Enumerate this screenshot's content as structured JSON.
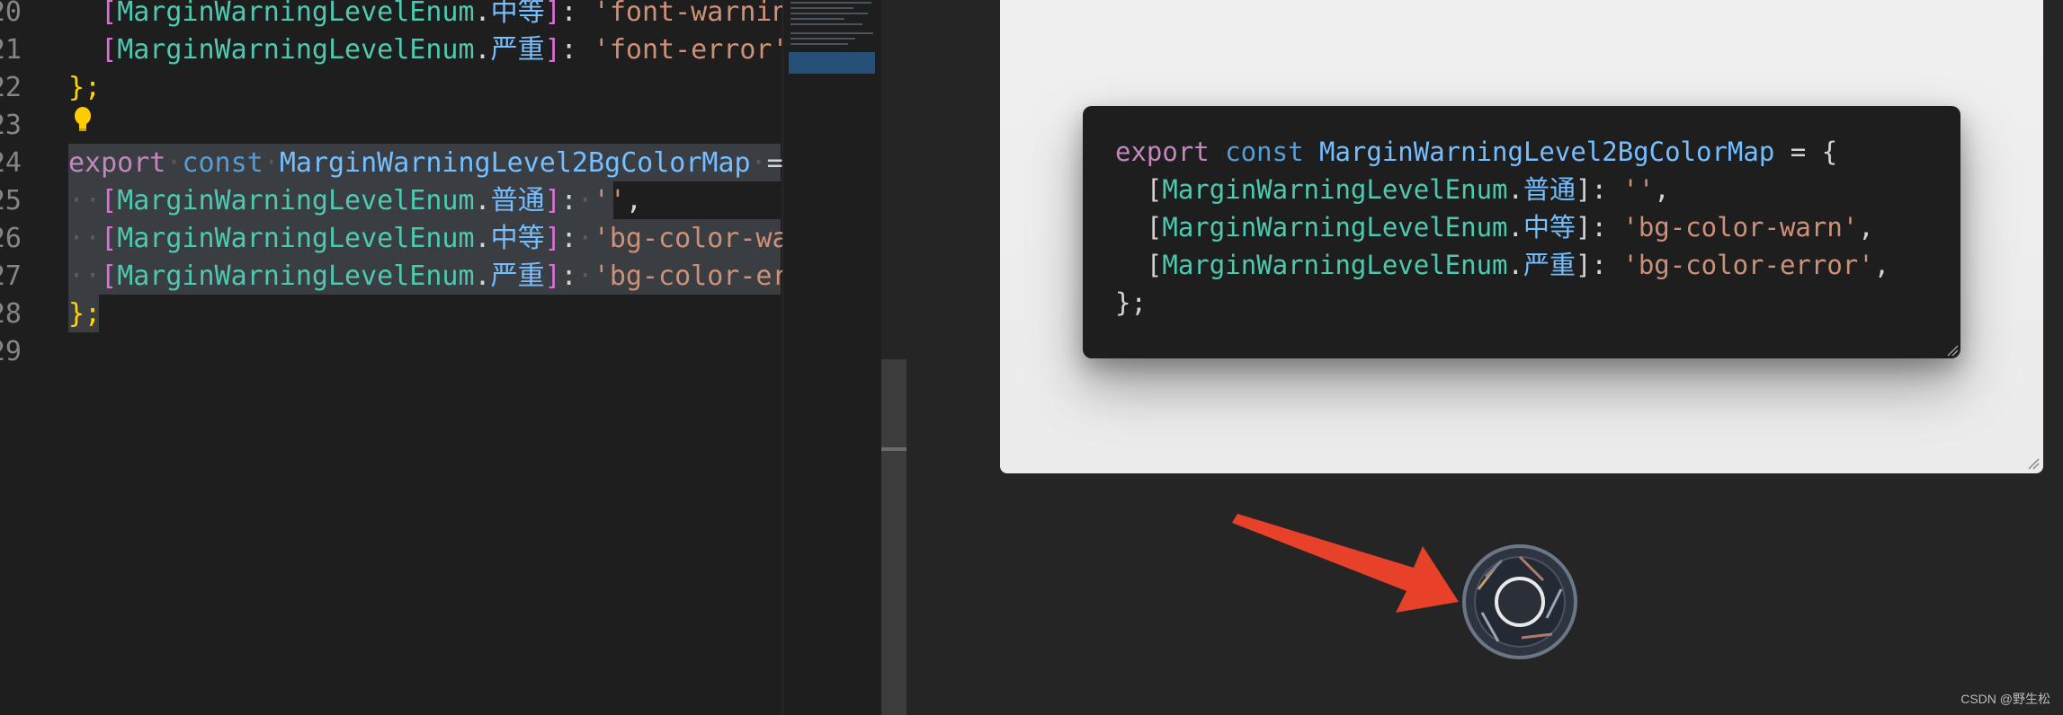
{
  "editor": {
    "lines": [
      {
        "num": "20",
        "parts": [
          {
            "t": "  "
          },
          {
            "t": "[",
            "c": "br2"
          },
          {
            "t": "MarginWarningLevelEnum",
            "c": "enum"
          },
          {
            "t": ".",
            "c": "punct"
          },
          {
            "t": "中等",
            "c": "id"
          },
          {
            "t": "]",
            "c": "br2"
          },
          {
            "t": ": ",
            "c": "punct"
          },
          {
            "t": "'font-warning'",
            "c": "str"
          },
          {
            "t": ",",
            "c": "punct"
          }
        ]
      },
      {
        "num": "21",
        "parts": [
          {
            "t": "  "
          },
          {
            "t": "[",
            "c": "br2"
          },
          {
            "t": "MarginWarningLevelEnum",
            "c": "enum"
          },
          {
            "t": ".",
            "c": "punct"
          },
          {
            "t": "严重",
            "c": "id"
          },
          {
            "t": "]",
            "c": "br2"
          },
          {
            "t": ": ",
            "c": "punct"
          },
          {
            "t": "'font-error'",
            "c": "str"
          },
          {
            "t": ",",
            "c": "punct"
          }
        ]
      },
      {
        "num": "22",
        "parts": [
          {
            "t": "};",
            "c": "brace"
          }
        ]
      },
      {
        "num": "23",
        "parts": []
      },
      {
        "num": "24",
        "parts": [
          {
            "t": "export",
            "c": "kw"
          },
          {
            "t": "·",
            "c": "dot"
          },
          {
            "t": "const",
            "c": "kw2"
          },
          {
            "t": "·",
            "c": "dot"
          },
          {
            "t": "MarginWarningLevel2BgColorMap",
            "c": "id"
          },
          {
            "t": "·",
            "c": "dot"
          },
          {
            "t": "=",
            "c": "punct"
          },
          {
            "t": "·",
            "c": "dot"
          },
          {
            "t": "{",
            "c": "brace"
          }
        ]
      },
      {
        "num": "25",
        "parts": [
          {
            "t": "··",
            "c": "dot"
          },
          {
            "t": "[",
            "c": "br2"
          },
          {
            "t": "MarginWarningLevelEnum",
            "c": "enum"
          },
          {
            "t": ".",
            "c": "punct"
          },
          {
            "t": "普通",
            "c": "id"
          },
          {
            "t": "]",
            "c": "br2"
          },
          {
            "t": ":",
            "c": "punct"
          },
          {
            "t": "·",
            "c": "dot"
          },
          {
            "t": "''",
            "c": "str"
          },
          {
            "t": ",",
            "c": "punct"
          }
        ]
      },
      {
        "num": "26",
        "parts": [
          {
            "t": "··",
            "c": "dot"
          },
          {
            "t": "[",
            "c": "br2"
          },
          {
            "t": "MarginWarningLevelEnum",
            "c": "enum"
          },
          {
            "t": ".",
            "c": "punct"
          },
          {
            "t": "中等",
            "c": "id"
          },
          {
            "t": "]",
            "c": "br2"
          },
          {
            "t": ":",
            "c": "punct"
          },
          {
            "t": "·",
            "c": "dot"
          },
          {
            "t": "'bg-color-warn'",
            "c": "str"
          }
        ]
      },
      {
        "num": "27",
        "parts": [
          {
            "t": "··",
            "c": "dot"
          },
          {
            "t": "[",
            "c": "br2"
          },
          {
            "t": "MarginWarningLevelEnum",
            "c": "enum"
          },
          {
            "t": ".",
            "c": "punct"
          },
          {
            "t": "严重",
            "c": "id"
          },
          {
            "t": "]",
            "c": "br2"
          },
          {
            "t": ":",
            "c": "punct"
          },
          {
            "t": "·",
            "c": "dot"
          },
          {
            "t": "'bg-color-error",
            "c": "str"
          }
        ]
      },
      {
        "num": "28",
        "parts": [
          {
            "t": "};",
            "c": "brace"
          }
        ]
      },
      {
        "num": "29",
        "parts": []
      }
    ]
  },
  "snippet": {
    "lines": [
      [
        {
          "t": "export",
          "c": "kw"
        },
        {
          "t": " const ",
          "c": "kw2"
        },
        {
          "t": "MarginWarningLevel2BgColorMap",
          "c": "id"
        },
        {
          "t": " = {",
          "c": "punct"
        }
      ],
      [
        {
          "t": "  [",
          "c": "punct"
        },
        {
          "t": "MarginWarningLevelEnum",
          "c": "enum"
        },
        {
          "t": ".",
          "c": "punct"
        },
        {
          "t": "普通",
          "c": "id"
        },
        {
          "t": "]: ",
          "c": "punct"
        },
        {
          "t": "''",
          "c": "str"
        },
        {
          "t": ",",
          "c": "punct"
        }
      ],
      [
        {
          "t": "  [",
          "c": "punct"
        },
        {
          "t": "MarginWarningLevelEnum",
          "c": "enum"
        },
        {
          "t": ".",
          "c": "punct"
        },
        {
          "t": "中等",
          "c": "id"
        },
        {
          "t": "]: ",
          "c": "punct"
        },
        {
          "t": "'bg-color-warn'",
          "c": "str"
        },
        {
          "t": ",",
          "c": "punct"
        }
      ],
      [
        {
          "t": "  [",
          "c": "punct"
        },
        {
          "t": "MarginWarningLevelEnum",
          "c": "enum"
        },
        {
          "t": ".",
          "c": "punct"
        },
        {
          "t": "严重",
          "c": "id"
        },
        {
          "t": "]: ",
          "c": "punct"
        },
        {
          "t": "'bg-color-error'",
          "c": "str"
        },
        {
          "t": ",",
          "c": "punct"
        }
      ],
      [
        {
          "t": "};",
          "c": "punct"
        }
      ]
    ]
  },
  "icons": {
    "lightbulb": "lightbulb-icon",
    "arrow": "red-arrow-icon",
    "capture": "camera-shutter-icon"
  },
  "colors": {
    "accent_arrow": "#e8412a",
    "card_bg": "#efefef",
    "editor_bg": "#1e1e1e"
  },
  "footer": {
    "watermark": "CSDN @野生松"
  }
}
